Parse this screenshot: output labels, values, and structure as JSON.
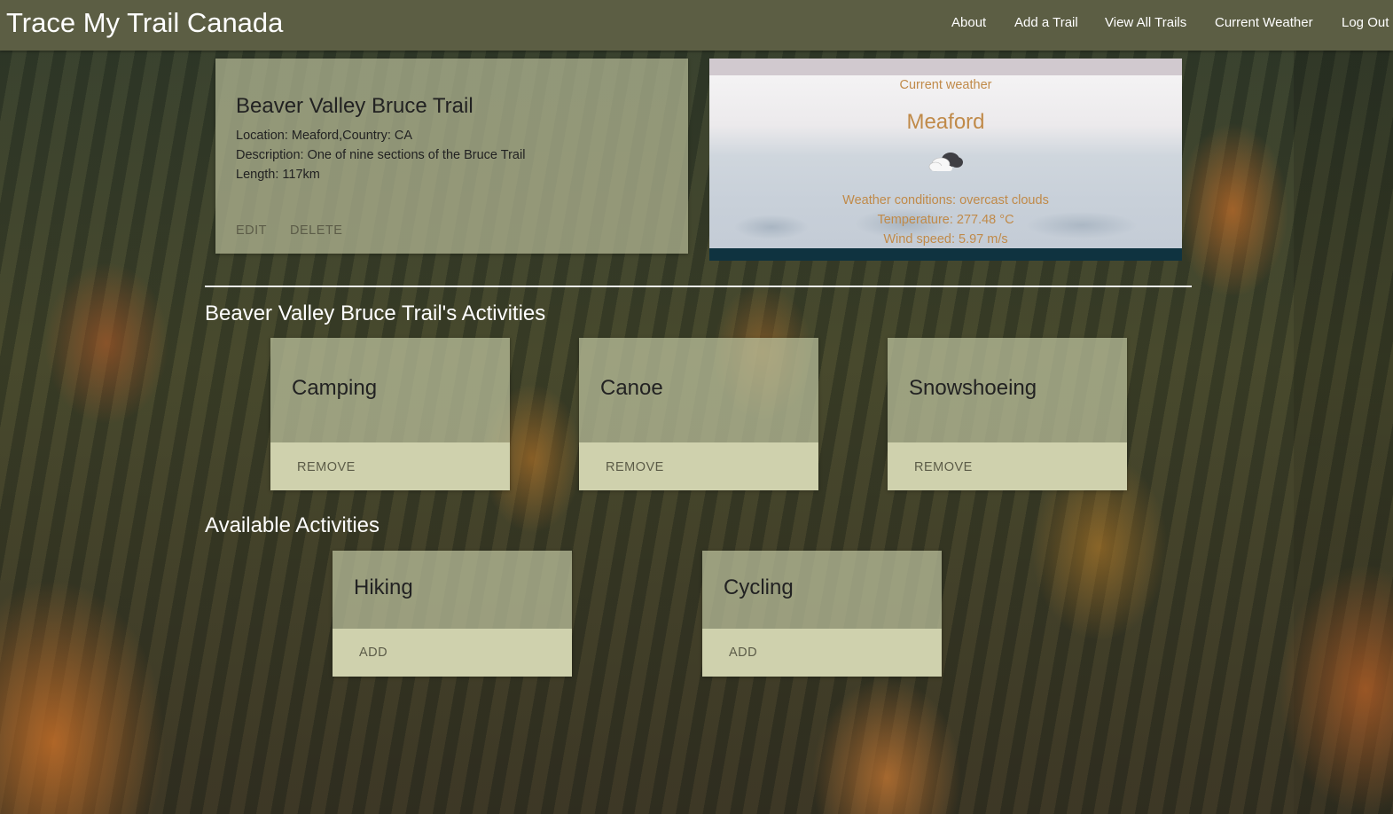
{
  "navbar": {
    "brand": "Trace My Trail Canada",
    "links": [
      "About",
      "Add a Trail",
      "View All Trails",
      "Current Weather",
      "Log Out"
    ]
  },
  "trail": {
    "name": "Beaver Valley Bruce Trail",
    "location": "Location: Meaford,Country: CA",
    "description": "Description: One of nine sections of the Bruce Trail",
    "length": "Length: 117km",
    "edit_label": "EDIT",
    "delete_label": "DELETE"
  },
  "weather": {
    "heading": "Current weather",
    "city": "Meaford",
    "icon": "cloud-icon",
    "conditions": "Weather conditions: overcast clouds",
    "temperature": "Temperature: 277.48 °C",
    "wind": "Wind speed: 5.97 m/s"
  },
  "activities": {
    "heading": "Beaver Valley Bruce Trail's Activities",
    "remove_label": "REMOVE",
    "items": [
      "Camping",
      "Canoe",
      "Snowshoeing"
    ]
  },
  "available": {
    "heading": "Available Activities",
    "add_label": "ADD",
    "items": [
      "Hiking",
      "Cycling"
    ]
  }
}
